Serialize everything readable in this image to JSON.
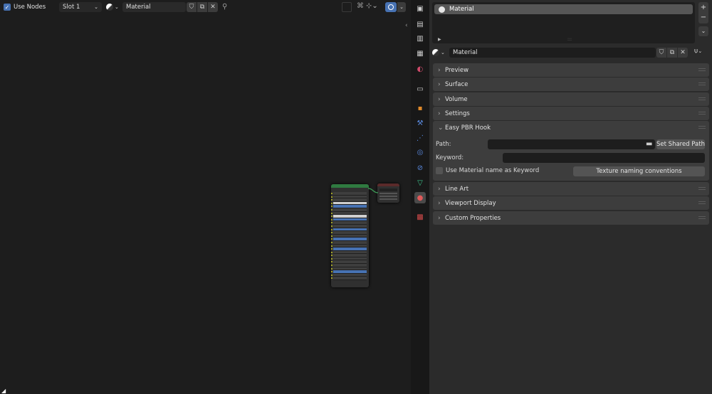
{
  "node_editor": {
    "use_nodes_label": "Use Nodes",
    "slot": "Slot 1",
    "material_name": "Material"
  },
  "material_list": {
    "items": [
      "Material"
    ]
  },
  "material_selector": {
    "name": "Material"
  },
  "panels": {
    "preview": "Preview",
    "surface": "Surface",
    "volume": "Volume",
    "settings": "Settings",
    "easy_pbr": "Easy PBR Hook",
    "line_art": "Line Art",
    "viewport_display": "Viewport Display",
    "custom_properties": "Custom Properties"
  },
  "easy_pbr": {
    "path_label": "Path:",
    "path_value": "",
    "set_shared_path": "Set Shared Path",
    "keyword_label": "Keyword:",
    "keyword_value": "",
    "use_material_name_label": "Use Material name as Keyword",
    "texture_naming_button": "Texture naming conventions"
  },
  "colors": {
    "accent": "#4772b3",
    "node_header": "#2f7a40",
    "panel_bg": "#3d3d3d",
    "editor_bg": "#1d1d1d"
  },
  "icons": [
    "checkbox-icon",
    "material-sphere-icon",
    "shield-icon",
    "duplicate-icon",
    "close-icon",
    "pin-icon",
    "collapse-icon",
    "add-icon",
    "remove-icon",
    "chevron-down-icon",
    "tool-tab-icon",
    "render-tab-icon",
    "output-tab-icon",
    "view-layer-tab-icon",
    "scene-tab-icon",
    "world-tab-icon",
    "collection-tab-icon",
    "object-tab-icon",
    "modifier-tab-icon",
    "particles-tab-icon",
    "physics-tab-icon",
    "constraints-tab-icon",
    "data-tab-icon",
    "material-tab-icon",
    "texture-tab-icon",
    "folder-icon",
    "node-tree-icon"
  ]
}
